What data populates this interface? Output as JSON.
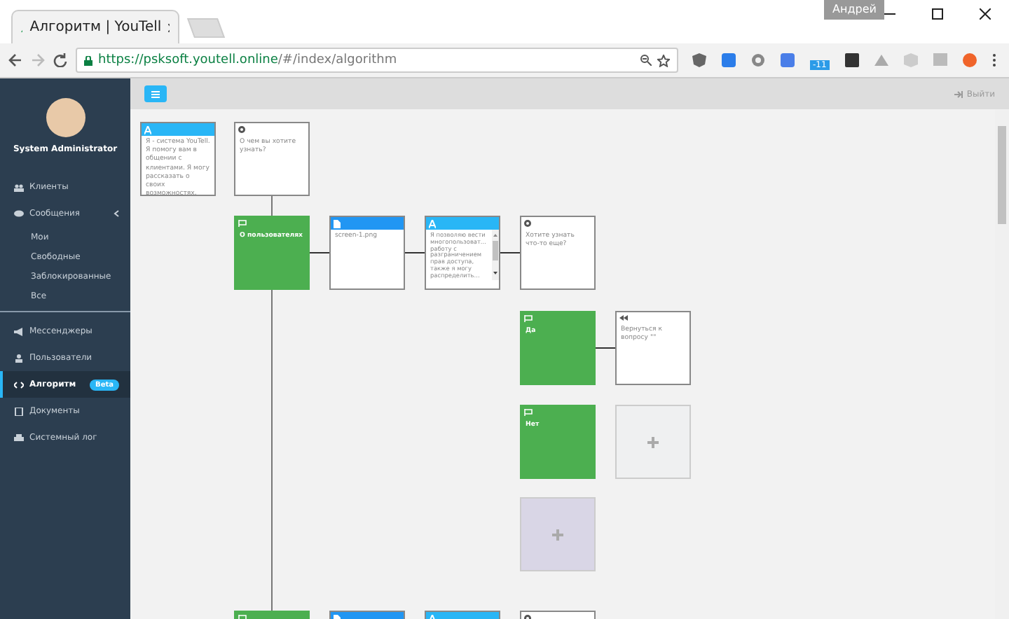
{
  "browser": {
    "tab_title": "Алгоритм | YouTell",
    "user": "Андрей",
    "url_host": "https://psksoft.youtell.online",
    "url_path": "/#/index/algorithm",
    "extension_badge": "-11"
  },
  "sidebar": {
    "user_name": "System Administrator",
    "items": [
      {
        "label": "Клиенты",
        "selected": false
      },
      {
        "label": "Сообщения",
        "selected": false,
        "expanded": true,
        "children": [
          {
            "label": "Мои",
            "selected": false
          },
          {
            "label": "Свободные",
            "selected": false
          },
          {
            "label": "Заблокированные",
            "selected": false
          },
          {
            "label": "Все",
            "selected": false
          }
        ]
      },
      {
        "label": "Мессенджеры",
        "selected": false
      },
      {
        "label": "Пользователи",
        "selected": false
      },
      {
        "label": "Алгоритм",
        "selected": true,
        "badge": "Beta"
      },
      {
        "label": "Документы",
        "selected": false
      },
      {
        "label": "Системный лог",
        "selected": false
      }
    ]
  },
  "topbar": {
    "logout": "Выйти"
  },
  "diagram": {
    "nodes": [
      {
        "kind": "text",
        "text": "Я - система YouTell. Я помогу вам в общении с клиентами. Я могу рассказать о своих возможностях."
      },
      {
        "kind": "question",
        "text": "О чем вы хотите узнать?"
      },
      {
        "kind": "answer",
        "text": "О пользователях"
      },
      {
        "kind": "file",
        "text": "screen-1.png"
      },
      {
        "kind": "text",
        "text": "Я позволяю вести многопользоват... работу с разграничением прав доступа, также я могу распределить...",
        "scroll": true
      },
      {
        "kind": "question",
        "text": "Хотите узнать что-то еще?"
      },
      {
        "kind": "answer",
        "text": "Да"
      },
      {
        "kind": "return",
        "text": "Вернуться к вопросу \"\""
      },
      {
        "kind": "answer",
        "text": "Нет"
      },
      {
        "kind": "add",
        "highlighted": false
      },
      {
        "kind": "add",
        "highlighted": true
      },
      {
        "kind": "answer"
      },
      {
        "kind": "file"
      },
      {
        "kind": "text"
      },
      {
        "kind": "question"
      }
    ]
  }
}
